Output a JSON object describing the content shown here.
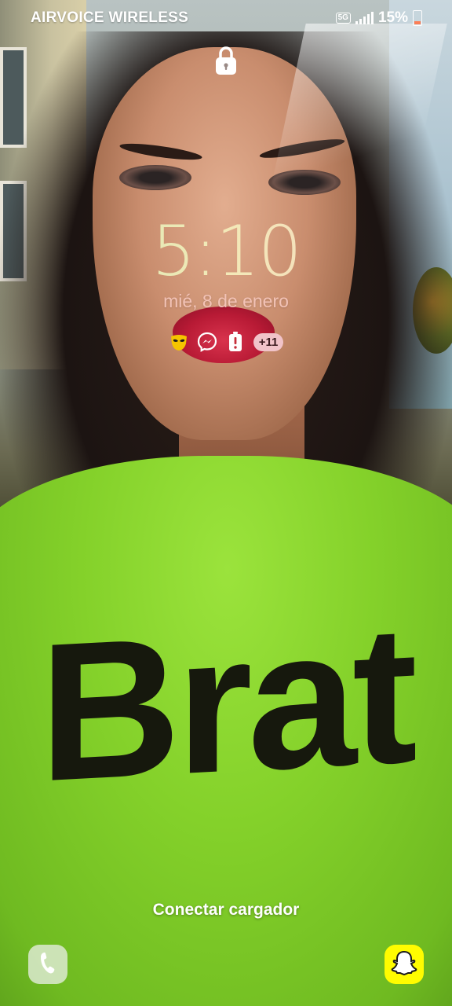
{
  "status_bar": {
    "carrier": "AIRVOICE WIRELESS",
    "network": "5G",
    "battery_percent": "15%",
    "battery_level": 0.15
  },
  "lockscreen": {
    "time": "5:10",
    "date": "mié, 8 de enero",
    "notification_icons": [
      "grindr-icon",
      "messenger-icon",
      "battery-warning-icon"
    ],
    "more_notifications": "+11",
    "charger_message": "Conectar cargador"
  },
  "shortcuts": {
    "left": "phone-icon",
    "right": "snapchat-icon"
  },
  "wallpaper": {
    "shirt_text": "Brat",
    "shirt_color": "#84d12a",
    "lip_color": "#c21d3a"
  },
  "colors": {
    "clock_gradient": [
      "#cfe9b0",
      "#f3e9b8",
      "#f6d2c2"
    ],
    "date_color": "#f3c3b7",
    "snapchat_yellow": "#fffc00"
  }
}
